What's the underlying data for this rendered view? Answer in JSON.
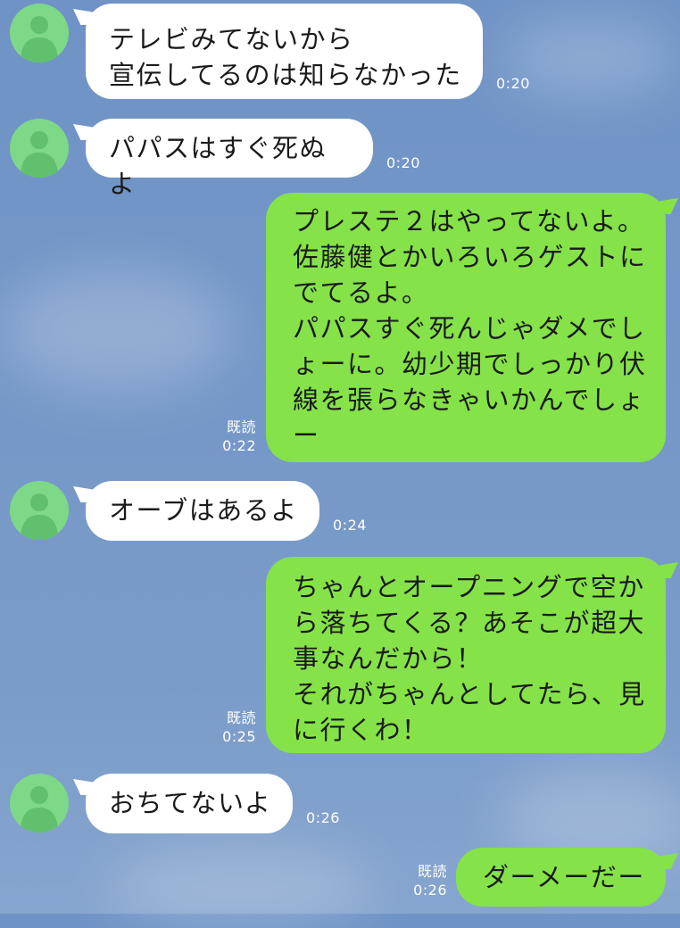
{
  "colors": {
    "background": "#7597c8",
    "incoming_bubble": "#ffffff",
    "outgoing_bubble": "#85e249",
    "avatar": "#7dd887"
  },
  "messages": [
    {
      "side": "incoming",
      "text": "テレビみてないから\n宣伝してるのは知らなかった",
      "time": "0:20"
    },
    {
      "side": "incoming",
      "text": "パパスはすぐ死ぬよ",
      "time": "0:20"
    },
    {
      "side": "outgoing",
      "text": "プレステ２はやってないよ。\n佐藤健とかいろいろゲストに\nでてるよ。\nパパスすぐ死んじゃダメでし\nょーに。幼少期でしっかり伏\n線を張らなきゃいかんでしょ\nー",
      "read": "既読",
      "time": "0:22"
    },
    {
      "side": "incoming",
      "text": "オーブはあるよ",
      "time": "0:24"
    },
    {
      "side": "outgoing",
      "text": "ちゃんとオープニングで空か\nら落ちてくる？あそこが超大\n事なんだから！\nそれがちゃんとしてたら、見\nに行くわ！",
      "read": "既読",
      "time": "0:25"
    },
    {
      "side": "incoming",
      "text": "おちてないよ",
      "time": "0:26"
    },
    {
      "side": "outgoing",
      "text": "ダーメーだー",
      "read": "既読",
      "time": "0:26"
    }
  ]
}
